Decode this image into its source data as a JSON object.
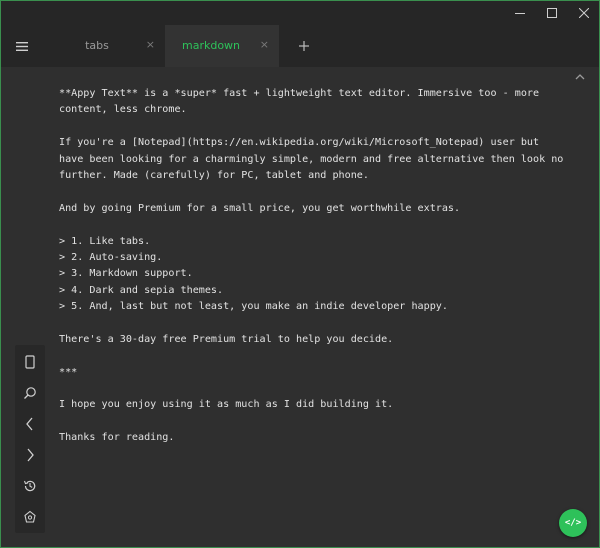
{
  "window": {
    "controls": [
      "minimize-icon",
      "maximize-icon",
      "close-icon"
    ]
  },
  "tabs": [
    {
      "label": "tabs",
      "close": "×",
      "active": false
    },
    {
      "label": "markdown",
      "close": "×",
      "active": true
    }
  ],
  "add_tab_icon": "plus-icon",
  "menu_icon": "hamburger-icon",
  "editor": {
    "lines": [
      "**Appy Text** is a *super* fast + lightweight text editor. Immersive too - more",
      "content, less chrome.",
      "",
      "If you're a [Notepad](https://en.wikipedia.org/wiki/Microsoft_Notepad) user but",
      "have been looking for a charmingly simple, modern and free alternative then look no",
      "further. Made (carefully) for PC, tablet and phone.",
      "",
      "And by going Premium for a small price, you get worthwhile extras.",
      "",
      "> 1. Like tabs.",
      "> 2. Auto-saving.",
      "> 3. Markdown support.",
      "> 4. Dark and sepia themes.",
      "> 5. And, last but not least, you make an indie developer happy.",
      "",
      "There's a 30-day free Premium trial to help you decide.",
      "",
      "***",
      "",
      "I hope you enjoy using it as much as I did building it.",
      "",
      "Thanks for reading."
    ]
  },
  "sidebar": {
    "items": [
      "document-icon",
      "search-icon",
      "chevron-left-icon",
      "chevron-right-icon",
      "history-icon",
      "theme-icon"
    ]
  },
  "fab": {
    "label": "</>"
  },
  "colors": {
    "accent": "#2ec15a",
    "background": "#2f2f2f",
    "chrome": "#262626",
    "text": "#e2e2e2"
  }
}
